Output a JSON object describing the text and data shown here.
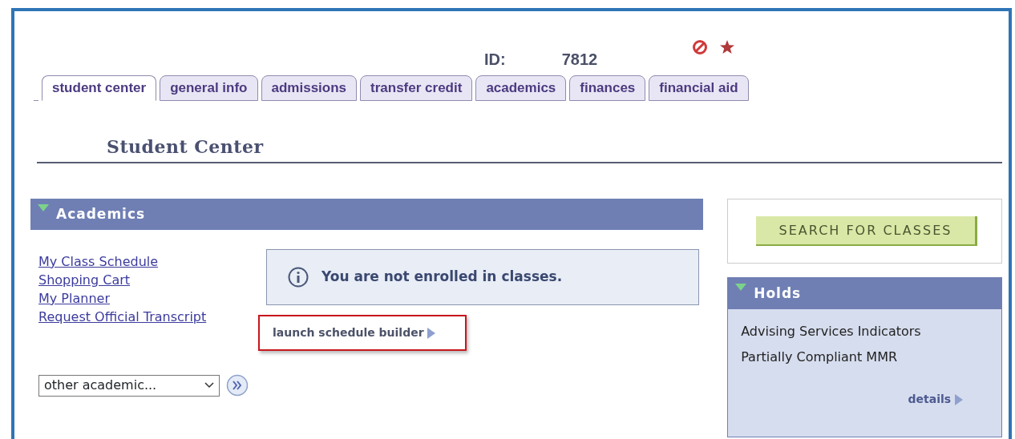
{
  "header": {
    "id_label": "ID:",
    "id_value": "7812"
  },
  "tabs": [
    {
      "label": "student center",
      "selected": true
    },
    {
      "label": "general info",
      "selected": false
    },
    {
      "label": "admissions",
      "selected": false
    },
    {
      "label": "transfer credit",
      "selected": false
    },
    {
      "label": "academics",
      "selected": false
    },
    {
      "label": "finances",
      "selected": false
    },
    {
      "label": "financial aid",
      "selected": false
    }
  ],
  "page_title": "Student Center",
  "academics": {
    "title": "Academics",
    "expanded": true,
    "links": [
      "My Class Schedule",
      "Shopping Cart",
      "My Planner",
      "Request Official Transcript"
    ],
    "message": "You are not enrolled in classes.",
    "schedule_link": "launch schedule builder",
    "dropdown": {
      "value": "other academic..."
    }
  },
  "search_button": "SEARCH FOR CLASSES",
  "holds": {
    "title": "Holds",
    "expanded": true,
    "items": [
      "Advising Services Indicators",
      "Partially Compliant MMR"
    ],
    "details_link": "details"
  }
}
